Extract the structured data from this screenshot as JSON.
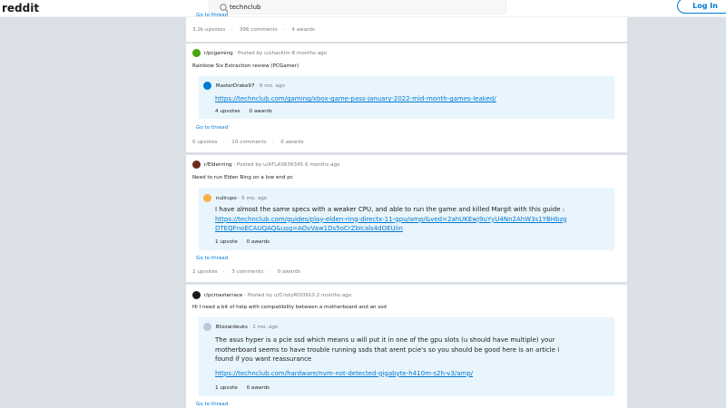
{
  "header": {
    "logo": "reddit",
    "search_value": "technclub",
    "login_label": "Log In"
  },
  "colors": {
    "accent": "#0079d3",
    "page_bg": "#dae0e6",
    "comment_bg": "#e9f5fd"
  },
  "top_card": {
    "goto": "Go to thread",
    "upvotes": "3.2k upvotes",
    "comments": "396 comments",
    "awards": "4 awards"
  },
  "posts": [
    {
      "subreddit": "r/pcgaming",
      "posted_by": "Posted by u/shackim 8 months ago",
      "title": "Rainbow Six Extraction review (PCGamer)",
      "comment_author": "MasterDrake97",
      "comment_age": "8 mo. ago",
      "comment_text": "",
      "comment_link": "https://technclub.com/gaming/xbox-game-pass-january-2022-mid-month-games-leaked/",
      "comment_upvotes": "4 upvotes",
      "comment_awards": "0 awards",
      "goto": "Go to thread",
      "upvotes": "0 upvotes",
      "comments": "10 comments",
      "awards": "0 awards",
      "icon_color": "#46a508"
    },
    {
      "subreddit": "r/Eldenring",
      "posted_by": "Posted by u/ATLAS636345 6 months ago",
      "title": "Need to run Elden Ring on a low end pc",
      "comment_author": "nullrupo",
      "comment_age": "6 mo. ago",
      "comment_text": "I have almost the same specs with a weaker CPU, and able to run the game and killed Margit with this guide :",
      "comment_link": "https://technclub.com/guides/play-elden-ring-directx-11-gpu/amp/&ved=2ahUKEwj9uYyU4Nn2AhW3s1YBHbzgDTEQFnoECAUQAQ&usg=AOvVaw1Ds5oCrZbIcals4dOEUiin",
      "comment_upvotes": "1 upvote",
      "comment_awards": "0 awards",
      "goto": "Go to thread",
      "upvotes": "2 upvotes",
      "comments": "3 comments",
      "awards": "0 awards",
      "icon_color": "#6b2a1a"
    },
    {
      "subreddit": "r/pcmasterrace",
      "posted_by": "Posted by u/CristyROO910 2 months ago",
      "title": "Hi I need a bit of help with compatibility between a motherboard and an ssd",
      "comment_author": "Blizzardeuks",
      "comment_age": "2 mo. ago",
      "comment_text": "The asus hyper is a pcie ssd which means u will put it in one of the gpu slots (u should have multiple) your motherboard seems to have trouble running ssds that arent pcie's so you should be good here is an article i found if you want reassurance",
      "comment_link": "https://technclub.com/hardware/nvm-not-detected-gigabyte-h410m-s2h-v3/amp/",
      "comment_upvotes": "1 upvote",
      "comment_awards": "0 awards",
      "goto": "Go to thread",
      "icon_color": "#1c1c1c"
    }
  ]
}
